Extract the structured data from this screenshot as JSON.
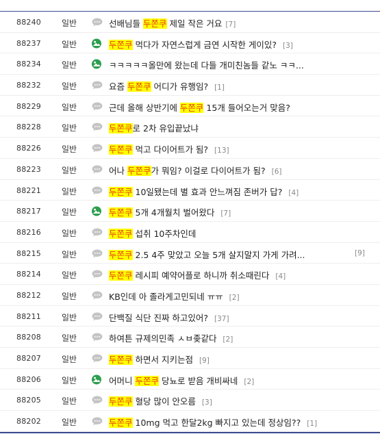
{
  "colors": {
    "accent_line": "#3b4890",
    "highlight_bg": "#ffff00",
    "highlight_fg": "#e8420c",
    "comment_count": "#888888",
    "image_icon": "#2e9e4f",
    "bubble_icon": "#c4c4c4"
  },
  "rows": [
    {
      "num": "88240",
      "cat": "일반",
      "icon": "speech-bubble-icon",
      "pre": "선배님들 ",
      "hl": "두쫀쿠",
      "post": " 제일 작은 거요",
      "count": "[7]"
    },
    {
      "num": "88237",
      "cat": "일반",
      "icon": "image-icon",
      "pre": "",
      "hl": "두쫀쿠",
      "post": " 먹다가 자연스럽게 금연 시작한 게이있? ",
      "count": "[3]"
    },
    {
      "num": "88234",
      "cat": "일반",
      "icon": "image-icon",
      "pre": "",
      "hl": "",
      "post": "ㅋㅋㅋㅋㅋ올만에 왔는데 다들 개미친놈들 같노 ㅋㅋ...",
      "count": ""
    },
    {
      "num": "88232",
      "cat": "일반",
      "icon": "speech-bubble-icon",
      "pre": "요즘 ",
      "hl": "두쫀쿠",
      "post": " 어디가 유행임? ",
      "count": "[1]"
    },
    {
      "num": "88229",
      "cat": "일반",
      "icon": "speech-bubble-icon",
      "pre": "근데 올해 상반기에 ",
      "hl": "두쫀쿠",
      "post": " 15개 들어오는거 맞음? ",
      "count": ""
    },
    {
      "num": "88228",
      "cat": "일반",
      "icon": "speech-bubble-icon",
      "pre": "",
      "hl": "두쫀쿠",
      "post": "로 2차 유입끝났냐",
      "count": ""
    },
    {
      "num": "88226",
      "cat": "일반",
      "icon": "speech-bubble-icon",
      "pre": "",
      "hl": "두쫀쿠",
      "post": " 먹고 다이어트가 됨? ",
      "count": "[13]"
    },
    {
      "num": "88223",
      "cat": "일반",
      "icon": "speech-bubble-icon",
      "pre": "어나 ",
      "hl": "두쫀쿠",
      "post": "가 뭐임? 이걸로 다이어트가 됨? ",
      "count": "[6]"
    },
    {
      "num": "88221",
      "cat": "일반",
      "icon": "speech-bubble-icon",
      "pre": "",
      "hl": "두쫀쿠",
      "post": " 10일됐는데 별 효과 안느껴짐 존버가 답? ",
      "count": "[4]"
    },
    {
      "num": "88217",
      "cat": "일반",
      "icon": "image-icon",
      "pre": "",
      "hl": "두쫀쿠",
      "post": " 5개 4개월치 벌어왔다 ",
      "count": "[7]"
    },
    {
      "num": "88216",
      "cat": "일반",
      "icon": "speech-bubble-icon",
      "pre": "",
      "hl": "두쫀쿠",
      "post": " 섭취 10주차인데",
      "count": ""
    },
    {
      "num": "88215",
      "cat": "일반",
      "icon": "speech-bubble-icon",
      "pre": "",
      "hl": "두쫀쿠",
      "post": " 2.5 4주 맞았고 오늘 5개 살지말지 가게 가려...",
      "count": "",
      "count_right": "[9]"
    },
    {
      "num": "88214",
      "cat": "일반",
      "icon": "speech-bubble-icon",
      "pre": "",
      "hl": "두쫀쿠",
      "post": " 레시피 예약어플로 하니까 취소때린다 ",
      "count": "[4]"
    },
    {
      "num": "88212",
      "cat": "일반",
      "icon": "speech-bubble-icon",
      "pre": "KB인데 아 졸라게고민되네 ㅠㅠ ",
      "hl": "",
      "post": "",
      "count": "[2]"
    },
    {
      "num": "88211",
      "cat": "일반",
      "icon": "speech-bubble-icon",
      "pre": "단백질 식단 진짜 하고있어? ",
      "hl": "",
      "post": "",
      "count": "[37]"
    },
    {
      "num": "88208",
      "cat": "일반",
      "icon": "speech-bubble-icon",
      "pre": "하여튼 규제의민족 ㅅㅂ좆같다 ",
      "hl": "",
      "post": "",
      "count": "[2]"
    },
    {
      "num": "88207",
      "cat": "일반",
      "icon": "speech-bubble-icon",
      "pre": "",
      "hl": "두쫀쿠",
      "post": " 하면서 지키는점 ",
      "count": "[9]"
    },
    {
      "num": "88206",
      "cat": "일반",
      "icon": "image-icon",
      "pre": "어머니 ",
      "hl": "두쫀쿠",
      "post": " 당뇨로 받음 개비싸네 ",
      "count": "[2]"
    },
    {
      "num": "88205",
      "cat": "일반",
      "icon": "speech-bubble-icon",
      "pre": "",
      "hl": "두쫀쿠",
      "post": " 혈당 많이 안오름 ",
      "count": "[3]"
    },
    {
      "num": "88202",
      "cat": "일반",
      "icon": "speech-bubble-icon",
      "pre": "",
      "hl": "두쫀쿠",
      "post": " 10mg 먹고 한달2kg 빠지고 있는데 정상임?? ",
      "count": "[1]"
    }
  ]
}
